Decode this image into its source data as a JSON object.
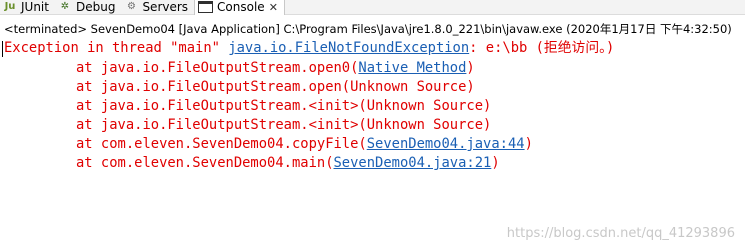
{
  "tabs": [
    {
      "icon": "junit-icon",
      "label": "JUnit"
    },
    {
      "icon": "debug-icon",
      "label": "Debug"
    },
    {
      "icon": "servers-icon",
      "label": "Servers"
    },
    {
      "icon": "console-icon",
      "label": "Console",
      "active": true
    }
  ],
  "close_symbol": "✕",
  "status": "<terminated> SevenDemo04 [Java Application] C:\\Program Files\\Java\\jre1.8.0_221\\bin\\javaw.exe (2020年1月17日 下午4:32:50)",
  "console": {
    "line0_prefix": "Exception in thread \"main\" ",
    "line0_link": "java.io.FileNotFoundException",
    "line0_suffix": ": e:\\bb (拒绝访问。)",
    "line1_prefix": "at java.io.FileOutputStream.open0(",
    "line1_link": "Native Method",
    "line1_suffix": ")",
    "line2": "at java.io.FileOutputStream.open(Unknown Source)",
    "line3": "at java.io.FileOutputStream.<init>(Unknown Source)",
    "line4": "at java.io.FileOutputStream.<init>(Unknown Source)",
    "line5_prefix": "at com.eleven.SevenDemo04.copyFile(",
    "line5_link": "SevenDemo04.java:44",
    "line5_suffix": ")",
    "line6_prefix": "at com.eleven.SevenDemo04.main(",
    "line6_link": "SevenDemo04.java:21",
    "line6_suffix": ")"
  },
  "watermark": "https://blog.csdn.net/qq_41293896",
  "colors": {
    "error": "#e00000",
    "link": "#1a5fb4"
  }
}
